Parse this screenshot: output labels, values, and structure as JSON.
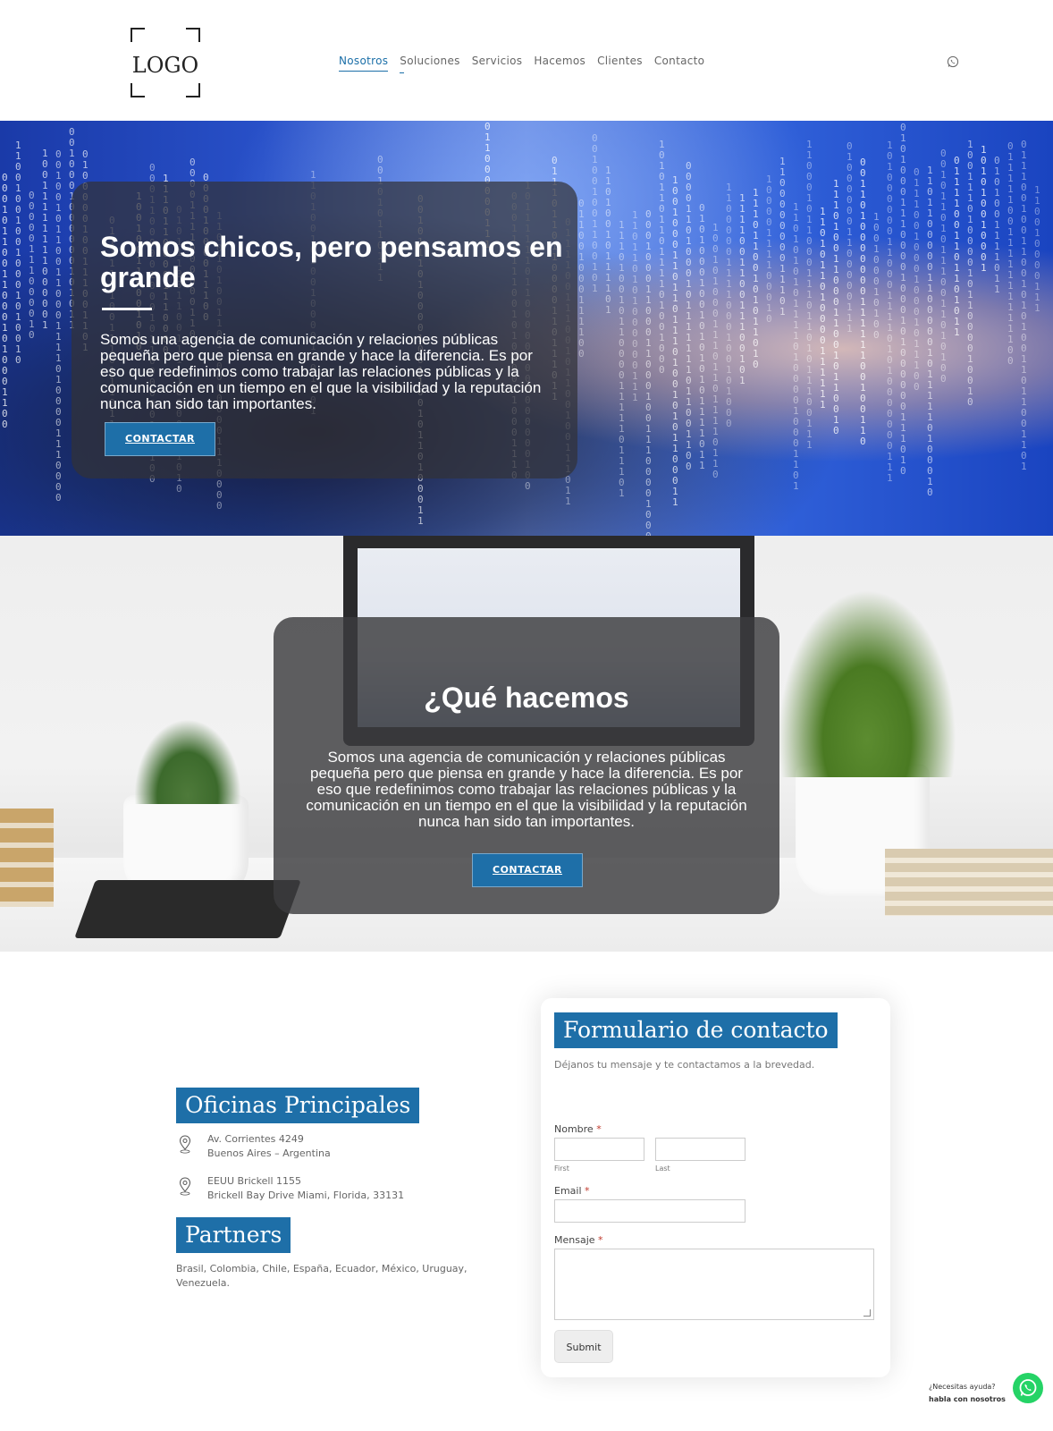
{
  "logo": {
    "text": "LOGO"
  },
  "nav": {
    "items": [
      {
        "label": "Nosotros",
        "state": "active"
      },
      {
        "label": "Soluciones",
        "state": "marked"
      },
      {
        "label": "Servicios",
        "state": "normal"
      },
      {
        "label": "Hacemos",
        "state": "normal"
      },
      {
        "label": "Clientes",
        "state": "normal"
      },
      {
        "label": "Contacto",
        "state": "normal"
      }
    ],
    "icon": "whatsapp-icon"
  },
  "hero1": {
    "title": "Somos chicos, pero pensamos en grande",
    "text": "Somos una agencia de comunicación y relaciones públicas pequeña pero que piensa en grande y hace la diferencia. Es por eso que redefinimos como trabajar las relaciones públicas y la comunicación en un tiempo en el que la visibilidad y la reputación nunca han sido tan importantes.",
    "button": "CONTACTAR"
  },
  "hero2": {
    "title": "¿Qué hacemos",
    "text": "Somos una agencia de comunicación y relaciones públicas pequeña pero que piensa en grande y hace la diferencia. Es por eso que redefinimos como trabajar las relaciones públicas y la comunicación en un tiempo en el que la visibilidad y la reputación nunca han sido tan importantes.",
    "button": "CONTACTAR"
  },
  "offices": {
    "title": "Oficinas Principales",
    "addresses": [
      {
        "line1": "Av. Corrientes 4249",
        "line2": "Buenos Aires – Argentina"
      },
      {
        "line1": "EEUU Brickell 1155",
        "line2": "Brickell Bay Drive Miami, Florida, 33131"
      }
    ]
  },
  "partners": {
    "title": "Partners",
    "text": "Brasil, Colombia,  Chile, España, Ecuador, México, Uruguay, Venezuela."
  },
  "form": {
    "title": "Formulario de contacto",
    "subtitle": "Déjanos tu mensaje y te contactamos a la brevedad.",
    "name_label": "Nombre",
    "required_mark": "*",
    "first_hint": "First",
    "last_hint": "Last",
    "email_label": "Email",
    "message_label": "Mensaje",
    "submit": "Submit"
  },
  "whatsapp_widget": {
    "text_normal": "¿Necesitas ayuda?",
    "text_bold": "habla con nosotros"
  },
  "colors": {
    "accent": "#1e6fa8",
    "whatsapp": "#25d366"
  }
}
